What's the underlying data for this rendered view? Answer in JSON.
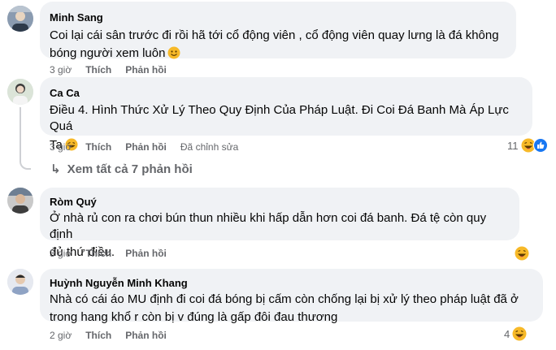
{
  "comments": [
    {
      "author": "Minh Sang",
      "lines": [
        "Coi lại cái sân trước đi rồi hã tới cổ động viên , cổ động viên quay lưng là đá không",
        "bóng người xem luôn"
      ],
      "emoji": "smile-emoji",
      "time": "3 giờ",
      "like_label": "Thích",
      "reply_label": "Phản hồi"
    },
    {
      "author": "Ca Ca",
      "lines": [
        "Điều 4. Hình Thức Xử Lý Theo Quy Định Của Pháp Luật. Đi Coi Đá Banh Mà Áp Lực Quá",
        "Ta"
      ],
      "emoji": "grin-emoji",
      "time": "3 giờ",
      "like_label": "Thích",
      "reply_label": "Phản hồi",
      "edited_label": "Đã chỉnh sửa",
      "reaction_count": "11",
      "reaction_icons": [
        "haha-icon",
        "like-icon"
      ]
    },
    {
      "author": "Ròm Quý",
      "lines": [
        "Ở nhà rủ con ra chơi bún thun nhiều khi hấp dẫn hơn coi đá banh. Đá tệ còn quy định",
        "đủ thứ điều."
      ],
      "time": "3 giờ",
      "like_label": "Thích",
      "reply_label": "Phản hồi",
      "reaction_icons": [
        "haha-icon"
      ]
    },
    {
      "author": "Huỳnh Nguyễn Minh Khang",
      "lines": [
        "Nhà có cái áo MU định đi coi đá bóng bị cấm còn chống lại bị xử lý theo pháp luật đã ở",
        "trong hang khổ r còn bị v đúng là gấp đôi đau thương"
      ],
      "time": "2 giờ",
      "like_label": "Thích",
      "reply_label": "Phản hồi",
      "reaction_count": "4",
      "reaction_icons": [
        "haha-icon"
      ]
    }
  ],
  "view_replies_label": "Xem tất cả 7 phản hồi",
  "colors": {
    "bubble": "#f0f2f5",
    "secondary_text": "#65676b",
    "like_blue": "#1877f2",
    "haha_yellow": "#f7b928"
  }
}
